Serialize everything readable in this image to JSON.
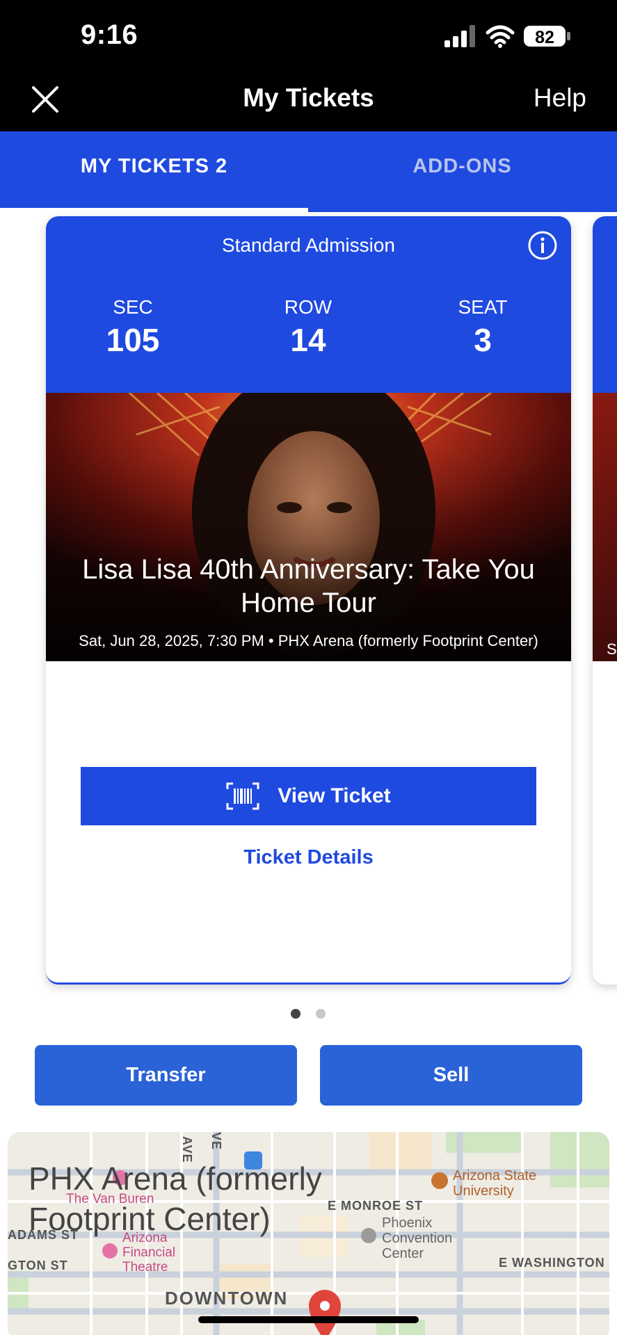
{
  "status_bar": {
    "time": "9:16",
    "battery": "82"
  },
  "nav": {
    "title": "My Tickets",
    "help_label": "Help"
  },
  "tabs": [
    {
      "label": "MY TICKETS 2",
      "active": true
    },
    {
      "label": "ADD-ONS",
      "active": false
    }
  ],
  "ticket": {
    "admission": "Standard Admission",
    "sec_label": "SEC",
    "sec_value": "105",
    "row_label": "ROW",
    "row_value": "14",
    "seat_label": "SEAT",
    "seat_value": "3",
    "event_title": "Lisa Lisa 40th Anniversary: Take You Home Tour",
    "event_meta": "Sat, Jun 28, 2025, 7:30 PM • PHX Arena (formerly Footprint Center)",
    "view_ticket_label": "View Ticket",
    "details_label": "Ticket Details"
  },
  "peek": {
    "letter": "S"
  },
  "pager": {
    "count": 2,
    "current": 1
  },
  "actions": {
    "transfer_label": "Transfer",
    "sell_label": "Sell"
  },
  "map": {
    "venue_title": "PHX Arena (formerly Footprint Center)",
    "streets": {
      "ave": "AVE",
      "ave2": "VE",
      "monroe": "E MONROE ST",
      "adams": "ADAMS ST",
      "washington": "E WASHINGTON",
      "gton": "GTON ST"
    },
    "pois": {
      "van_buren": "The Van Buren",
      "financial_theatre": "Arizona Financial Theatre",
      "convention_center": "Phoenix Convention Center",
      "asu": "Arizona State University"
    },
    "district": "DOWNTOWN"
  },
  "colors": {
    "brand_blue": "#1f4ae0",
    "action_blue": "#2a62d8",
    "topbar": "#000000"
  }
}
